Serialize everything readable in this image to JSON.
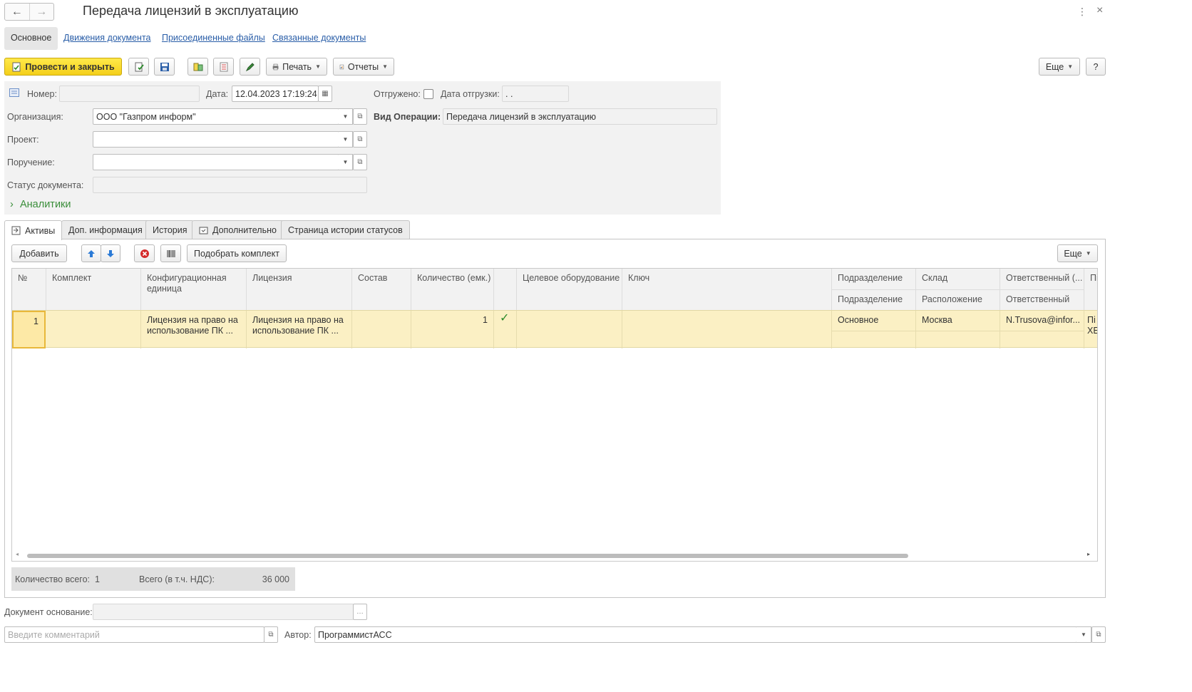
{
  "window": {
    "title": "Передача лицензий в эксплуатацию",
    "back_icon": "←",
    "forward_icon": "→",
    "menu_icon": "⋮",
    "close_icon": "×"
  },
  "form_tabs": [
    {
      "label": "Основное",
      "active": true
    },
    {
      "label": "Движения документа"
    },
    {
      "label": "Присоединенные файлы"
    },
    {
      "label": "Связанные документы"
    }
  ],
  "toolbar": {
    "post_and_close": "Провести и закрыть",
    "print": "Печать",
    "reports": "Отчеты",
    "more": "Еще",
    "help": "?"
  },
  "header": {
    "number_label": "Номер:",
    "number_value": "",
    "date_label": "Дата:",
    "date_value": "12.04.2023 17:19:24",
    "shipped_label": "Отгружено:",
    "ship_date_label": "Дата отгрузки:",
    "ship_date_value": " .  .",
    "org_label": "Организация:",
    "org_value": "ООО \"Газпром информ\"",
    "op_type_label": "Вид Операции:",
    "op_type_value": "Передача лицензий в эксплуатацию",
    "project_label": "Проект:",
    "project_value": "",
    "assignment_label": "Поручение:",
    "assignment_value": "",
    "status_label": "Статус документа:",
    "status_value": "",
    "analytics_label": "Аналитики",
    "analytics_chevron": "›"
  },
  "content_tabs": [
    {
      "label": "Активы",
      "active": true
    },
    {
      "label": "Доп. информация"
    },
    {
      "label": "История"
    },
    {
      "label": "Дополнительно"
    },
    {
      "label": "Страница истории статусов"
    }
  ],
  "table_toolbar": {
    "add": "Добавить",
    "pick_kit": "Подобрать комплект",
    "more": "Еще"
  },
  "table": {
    "columns": {
      "num": "№",
      "kit": "Комплект",
      "config_unit": "Конфигурационная единица",
      "license": "Лицензия",
      "composition": "Состав",
      "quantity": "Количество (емк.)",
      "target_equipment": "Целевое оборудование",
      "key": "Ключ",
      "division": "Подразделение",
      "warehouse": "Склад",
      "responsible": "Ответственный (...",
      "next": "Пі"
    },
    "subcolumns": {
      "division": "Подразделение",
      "location": "Расположение",
      "responsible": "Ответственный"
    },
    "rows": [
      {
        "num": "1",
        "kit": "",
        "config_unit": "Лицензия на право на использование ПК ...",
        "license": "Лицензия на право на использование ПК ...",
        "composition": "",
        "quantity": "1",
        "check": "✓",
        "target_equipment": "",
        "key": "",
        "division": "Основное",
        "warehouse": "Москва",
        "responsible": "N.Trusova@infor...",
        "next": "Пі ХЕ"
      }
    ]
  },
  "totals": {
    "count_label": "Количество всего:",
    "count_value": "1",
    "total_label": "Всего (в т.ч. НДС):",
    "total_value": "36 000"
  },
  "footer": {
    "basis_label": "Документ основание:",
    "basis_value": "",
    "comment_placeholder": "Введите комментарий",
    "author_label": "Автор:",
    "author_value": "ПрограммистАСС"
  }
}
